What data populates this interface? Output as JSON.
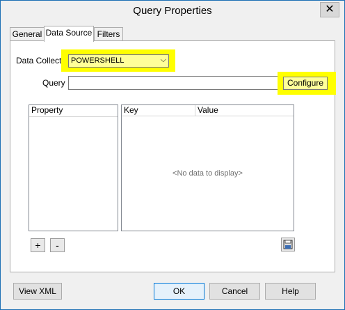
{
  "window": {
    "title": "Query Properties",
    "close_glyph": "✕"
  },
  "tabs": [
    {
      "label": "General",
      "active": false
    },
    {
      "label": "Data Source",
      "active": true
    },
    {
      "label": "Filters",
      "active": false
    }
  ],
  "data_source": {
    "collector_label": "Data Collector",
    "collector_value": "POWERSHELL",
    "query_label": "Query",
    "query_value": "",
    "configure_label": "Configure",
    "highlight_color": "#ffff00"
  },
  "property_list": {
    "header": "Property"
  },
  "kv_grid": {
    "columns": [
      "Key",
      "Value"
    ],
    "empty_text": "<No data to display>"
  },
  "list_buttons": {
    "add": "+",
    "remove": "-",
    "save_icon": "save-icon"
  },
  "footer": {
    "view_xml": "View XML",
    "ok": "OK",
    "cancel": "Cancel",
    "help": "Help"
  }
}
